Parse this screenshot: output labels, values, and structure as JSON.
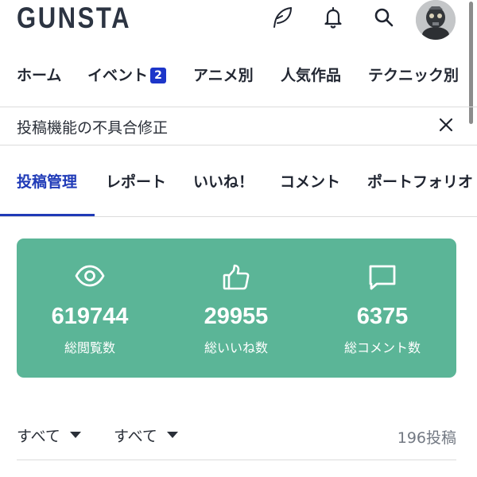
{
  "header": {
    "logo": "GUNSTA",
    "icons": [
      "feather-icon",
      "bell-icon",
      "search-icon"
    ],
    "avatar": "avatar"
  },
  "main_nav": [
    {
      "label": "ホーム"
    },
    {
      "label": "イベント",
      "badge": "2"
    },
    {
      "label": "アニメ別"
    },
    {
      "label": "人気作品"
    },
    {
      "label": "テクニック別"
    }
  ],
  "notice": {
    "text": "投稿機能の不具合修正",
    "close_icon": "close-icon"
  },
  "sub_tabs": [
    {
      "label": "投稿管理",
      "active": true
    },
    {
      "label": "レポート"
    },
    {
      "label": "いいね！"
    },
    {
      "label": "コメント"
    },
    {
      "label": "ポートフォリオ"
    }
  ],
  "stats": {
    "background": "#5bb597",
    "items": [
      {
        "icon": "eye-icon",
        "value": "619744",
        "label": "総閲覧数"
      },
      {
        "icon": "thumbs-up-icon",
        "value": "29955",
        "label": "総いいね数"
      },
      {
        "icon": "comment-icon",
        "value": "6375",
        "label": "総コメント数"
      }
    ]
  },
  "filters": [
    {
      "label": "すべて"
    },
    {
      "label": "すべて"
    }
  ],
  "post_count": "196投稿",
  "colors": {
    "accent": "#1f3ab7",
    "badge": "#1d36c9",
    "text": "#1f2430"
  }
}
